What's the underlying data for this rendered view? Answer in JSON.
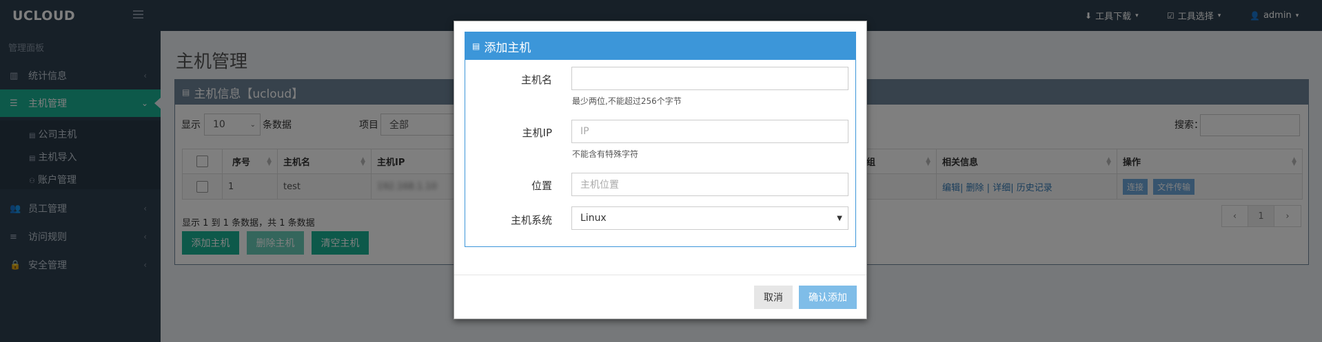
{
  "app": {
    "logo": "UCLOUD"
  },
  "topnav": {
    "download": {
      "icon": "download-icon",
      "label": "工具下载"
    },
    "select": {
      "icon": "checkbox-icon",
      "label": "工具选择"
    },
    "user": {
      "icon": "user-icon",
      "label": "admin"
    }
  },
  "sidebar": {
    "header": "管理面板",
    "items": [
      {
        "icon": "bar-chart-icon",
        "label": "统计信息"
      },
      {
        "icon": "server-icon",
        "label": "主机管理"
      },
      {
        "icon": "users-icon",
        "label": "员工管理"
      },
      {
        "icon": "list-icon",
        "label": "访问规则"
      },
      {
        "icon": "lock-icon",
        "label": "安全管理"
      }
    ],
    "subitems": [
      {
        "icon": "list-icon",
        "label": "公司主机"
      },
      {
        "icon": "list-icon",
        "label": "主机导入"
      },
      {
        "icon": "accounts-icon",
        "label": "账户管理"
      }
    ]
  },
  "main": {
    "page_title": "主机管理",
    "panel_title": "主机信息【ucloud】",
    "show_label": "显示",
    "page_size": "10",
    "page_size_suffix": "条数据",
    "project_label": "项目",
    "project_value": "全部",
    "search_label": "搜索：",
    "columns": [
      "序号",
      "主机名",
      "主机IP",
      "组",
      "相关信息",
      "操作"
    ],
    "row": {
      "index": "1",
      "hostname": "test",
      "ip": "192.168.1.10",
      "links": [
        "编辑",
        "删除",
        "详细",
        "历史记录"
      ],
      "actions": [
        "连接",
        "文件传输"
      ]
    },
    "summary": "显示 1 到 1 条数据，共 1 条数据",
    "buttons": {
      "add": "添加主机",
      "delete": "删除主机",
      "clear": "清空主机"
    },
    "pager": {
      "prev": "‹",
      "current": "1",
      "next": "›"
    }
  },
  "modal": {
    "title": "添加主机",
    "fields": {
      "hostname": {
        "label": "主机名",
        "value": "",
        "placeholder": "",
        "help": "最少两位,不能超过256个字节"
      },
      "ip": {
        "label": "主机IP",
        "value": "",
        "placeholder": "IP",
        "help": "不能含有特殊字符"
      },
      "location": {
        "label": "位置",
        "value": "",
        "placeholder": "主机位置"
      },
      "os": {
        "label": "主机系统",
        "value": "Linux"
      }
    },
    "cancel_label": "取消",
    "confirm_label": "确认添加"
  },
  "colors": {
    "sidebar": "#2f4050",
    "accent": "#1ab394",
    "modal_header": "#3c96d9",
    "panel_header": "#6f8599"
  }
}
